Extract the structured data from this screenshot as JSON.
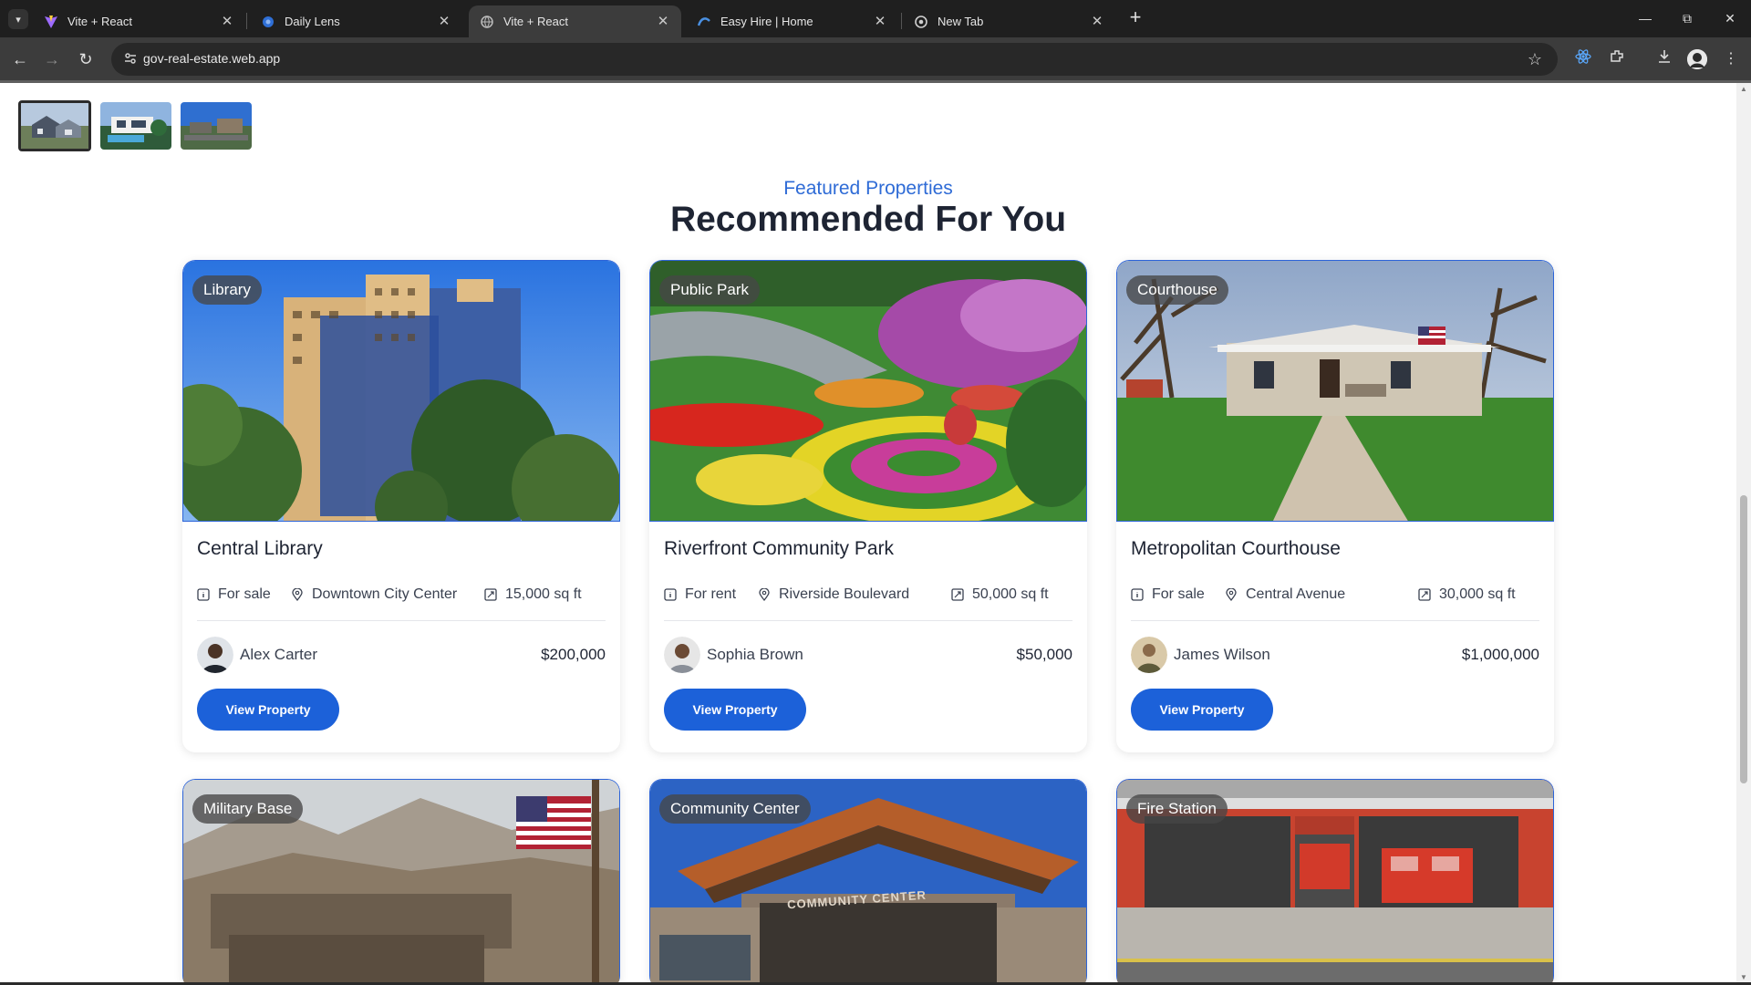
{
  "browser": {
    "tabs": [
      {
        "title": "Vite + React",
        "active": false
      },
      {
        "title": "Daily Lens",
        "active": false
      },
      {
        "title": "Vite + React",
        "active": true
      },
      {
        "title": "Easy Hire | Home",
        "active": false
      },
      {
        "title": "New Tab",
        "active": false
      }
    ],
    "url": "gov-real-estate.web.app"
  },
  "section": {
    "eyebrow": "Featured Properties",
    "heading": "Recommended For You"
  },
  "properties": [
    {
      "category": "Library",
      "name": "Central Library",
      "status": "For sale",
      "location": "Downtown City Center",
      "area": "15,000 sq ft",
      "owner": "Alex Carter",
      "price": "$200,000",
      "cta": "View Property"
    },
    {
      "category": "Public Park",
      "name": "Riverfront Community Park",
      "status": "For rent",
      "location": "Riverside Boulevard",
      "area": "50,000 sq ft",
      "owner": "Sophia Brown",
      "price": "$50,000",
      "cta": "View Property"
    },
    {
      "category": "Courthouse",
      "name": "Metropolitan Courthouse",
      "status": "For sale",
      "location": "Central Avenue",
      "area": "30,000 sq ft",
      "owner": "James Wilson",
      "price": "$1,000,000",
      "cta": "View Property"
    },
    {
      "category": "Military Base"
    },
    {
      "category": "Community Center",
      "sign_text": "COMMUNITY CENTER"
    },
    {
      "category": "Fire Station"
    }
  ],
  "colors": {
    "accent": "#1c61d9",
    "eyebrow": "#2e6bd6",
    "heading": "#1e2433"
  }
}
